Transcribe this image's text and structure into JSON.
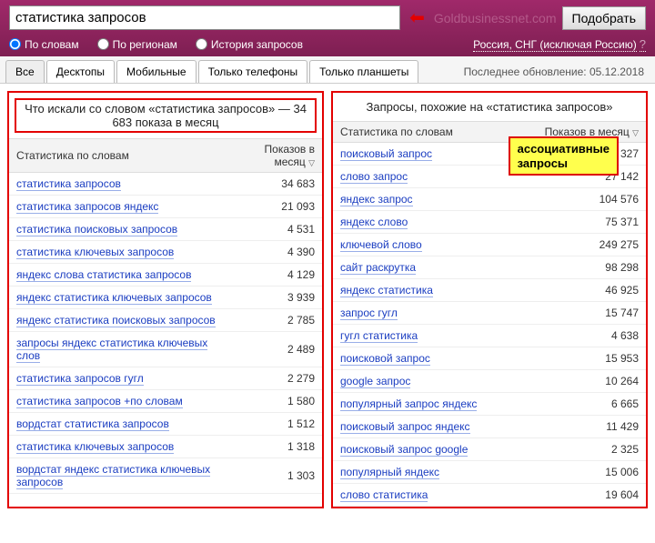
{
  "header": {
    "search_value": "статистика запросов",
    "watermark": "Goldbusinessnet.com",
    "submit_label": "Подобрать",
    "radios": [
      {
        "label": "По словам",
        "checked": true
      },
      {
        "label": "По регионам",
        "checked": false
      },
      {
        "label": "История запросов",
        "checked": false
      }
    ],
    "region_text": "Россия, СНГ (исключая Россию)"
  },
  "tabs": {
    "items": [
      "Все",
      "Десктопы",
      "Мобильные",
      "Только телефоны",
      "Только планшеты"
    ],
    "update_label": "Последнее обновление: 05.12.2018"
  },
  "left": {
    "title": "Что искали со словом «статистика запросов» — 34 683 показа в месяц",
    "col1": "Статистика по словам",
    "col2": "Показов в месяц",
    "rows": [
      {
        "q": "статистика запросов",
        "n": "34 683"
      },
      {
        "q": "статистика запросов яндекс",
        "n": "21 093"
      },
      {
        "q": "статистика поисковых запросов",
        "n": "4 531"
      },
      {
        "q": "статистика ключевых запросов",
        "n": "4 390"
      },
      {
        "q": "яндекс слова статистика запросов",
        "n": "4 129"
      },
      {
        "q": "яндекс статистика ключевых запросов",
        "n": "3 939"
      },
      {
        "q": "яндекс статистика поисковых запросов",
        "n": "2 785"
      },
      {
        "q": "запросы яндекс статистика ключевых слов",
        "n": "2 489"
      },
      {
        "q": "статистика запросов гугл",
        "n": "2 279"
      },
      {
        "q": "статистика запросов +по словам",
        "n": "1 580"
      },
      {
        "q": "вордстат статистика запросов",
        "n": "1 512"
      },
      {
        "q": "статистика ключевых запросов",
        "n": "1 318"
      },
      {
        "q": "вордстат яндекс статистика ключевых запросов",
        "n": "1 303"
      }
    ]
  },
  "right": {
    "title": "Запросы, похожие на «статистика запросов»",
    "col1": "Статистика по словам",
    "col2": "Показов в месяц",
    "callout": "ассоциативные запросы",
    "rows": [
      {
        "q": "поисковый запрос",
        "n": "109 327"
      },
      {
        "q": "слово запрос",
        "n": "27 142"
      },
      {
        "q": "яндекс запрос",
        "n": "104 576"
      },
      {
        "q": "яндекс слово",
        "n": "75 371"
      },
      {
        "q": "ключевой слово",
        "n": "249 275"
      },
      {
        "q": "сайт раскрутка",
        "n": "98 298"
      },
      {
        "q": "яндекс статистика",
        "n": "46 925"
      },
      {
        "q": "запрос гугл",
        "n": "15 747"
      },
      {
        "q": "гугл статистика",
        "n": "4 638"
      },
      {
        "q": "поисковой запрос",
        "n": "15 953"
      },
      {
        "q": "google запрос",
        "n": "10 264"
      },
      {
        "q": "популярный запрос яндекс",
        "n": "6 665"
      },
      {
        "q": "поисковый запрос яндекс",
        "n": "11 429"
      },
      {
        "q": "поисковый запрос google",
        "n": "2 325"
      },
      {
        "q": "популярный яндекс",
        "n": "15 006"
      },
      {
        "q": "слово статистика",
        "n": "19 604"
      }
    ]
  }
}
